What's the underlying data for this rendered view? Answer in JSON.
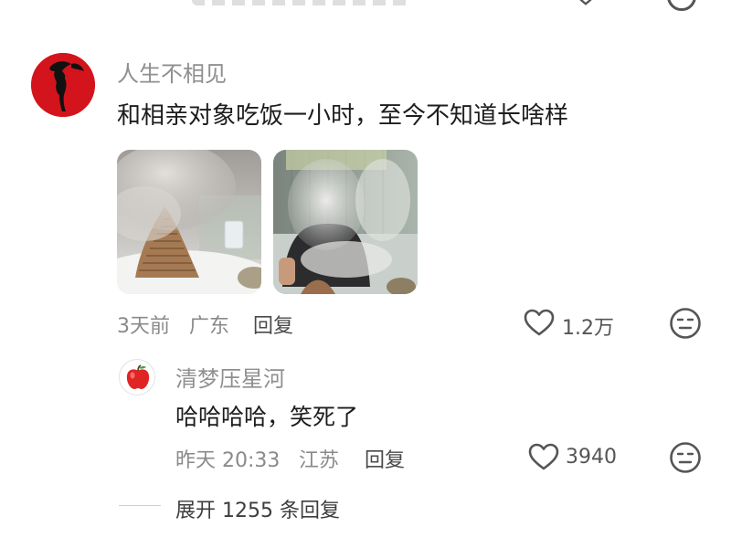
{
  "comment": {
    "username": "人生不相见",
    "text": "和相亲对象吃饭一小时，至今不知道长啥样",
    "time": "3天前",
    "location": "广东",
    "reply_label": "回复",
    "likes": "1.2万",
    "images": [
      {
        "icon": "photo-fog-sculpture"
      },
      {
        "icon": "photo-fog-person"
      }
    ],
    "avatar_icon": "red-dancer-avatar",
    "accent_color": "#d3141d"
  },
  "reply": {
    "username": "清梦压星河",
    "text": "哈哈哈哈，笑死了",
    "time": "昨天 20:33",
    "location": "江苏",
    "reply_label": "回复",
    "likes": "3940",
    "avatar_icon": "apple-avatar"
  },
  "expand": {
    "label": "展开 1255 条回复"
  },
  "icons": {
    "like": "heart-icon",
    "emoji": "neutral-face-icon"
  }
}
